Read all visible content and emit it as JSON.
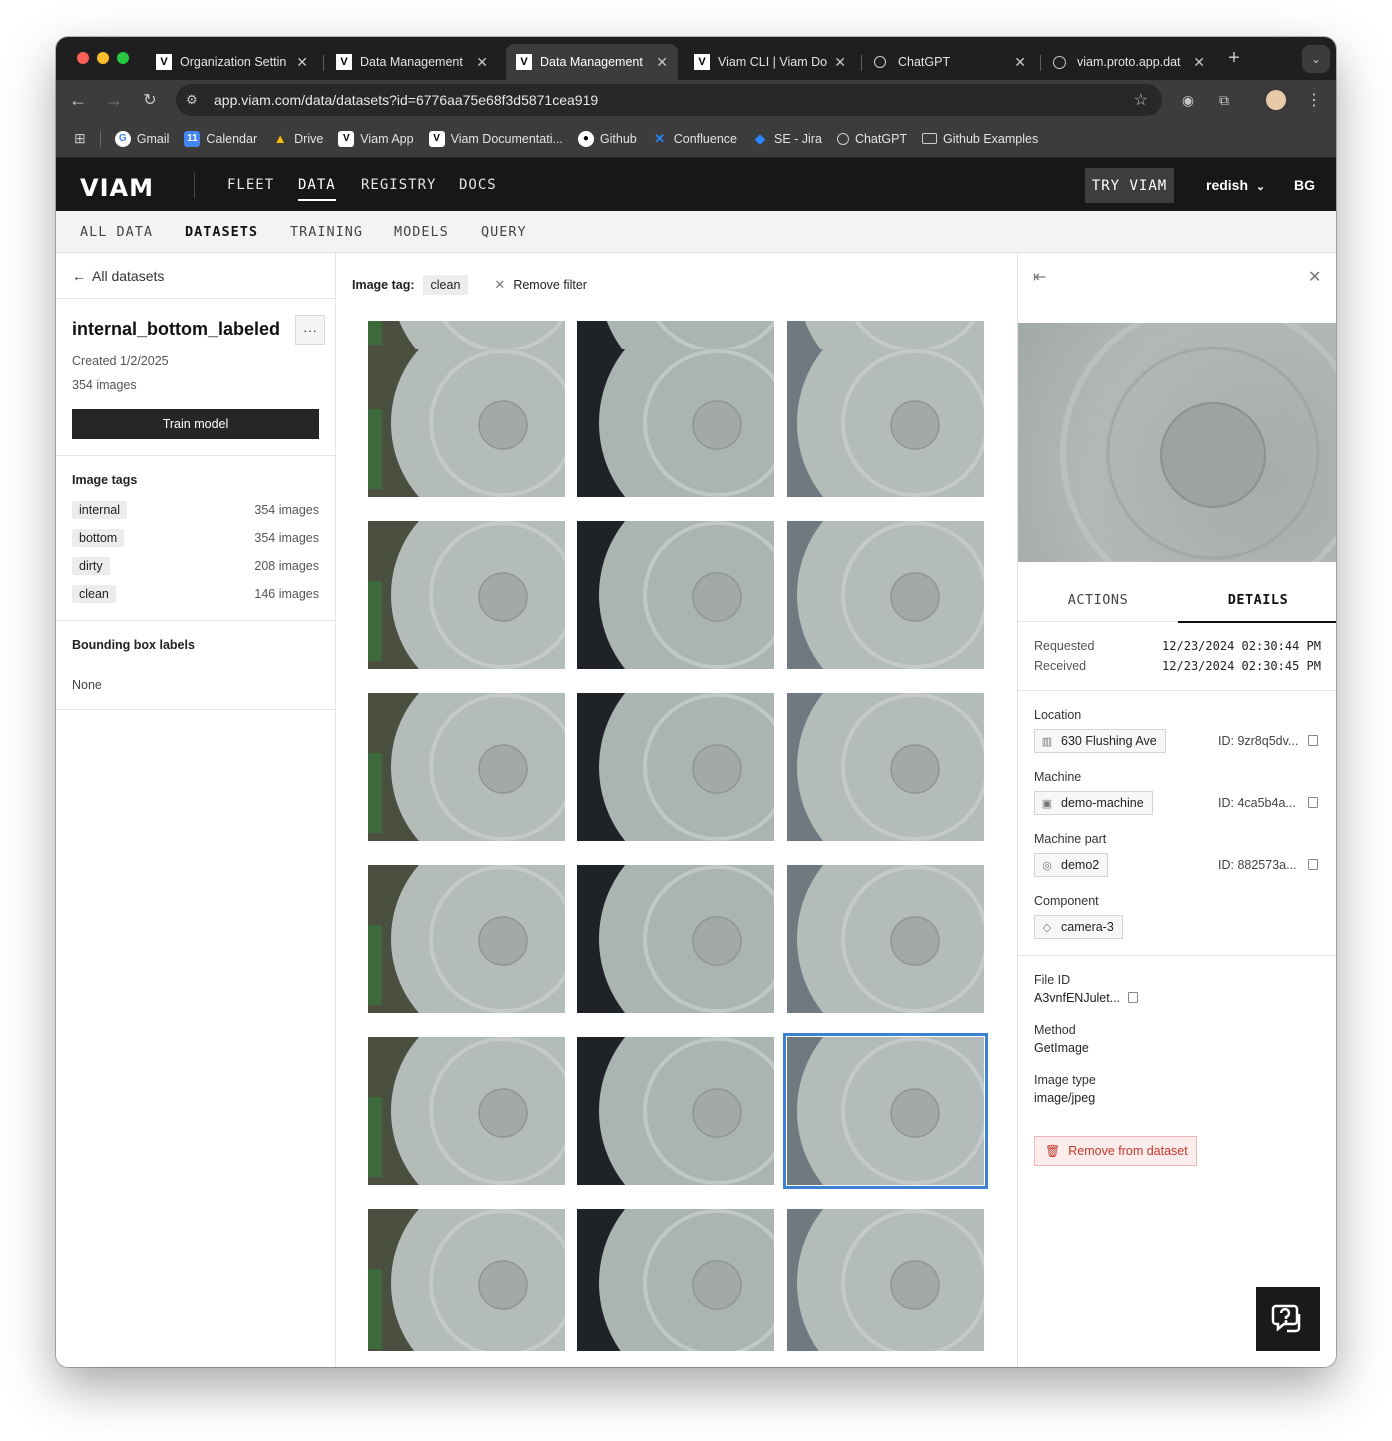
{
  "browser": {
    "tabs": [
      {
        "title": "Organization Settin",
        "icon": "viam-icon"
      },
      {
        "title": "Data Management",
        "icon": "viam-icon"
      },
      {
        "title": "Data Management",
        "icon": "viam-icon",
        "active": true
      },
      {
        "title": "Viam CLI | Viam Do",
        "icon": "viam-icon"
      },
      {
        "title": "ChatGPT",
        "icon": "openai-icon"
      },
      {
        "title": "viam.proto.app.dat",
        "icon": "globe-icon"
      }
    ],
    "url": "app.viam.com/data/datasets?id=6776aa75e68f3d5871cea919",
    "bookmarks": [
      "Gmail",
      "Calendar",
      "Drive",
      "Viam App",
      "Viam Documentati...",
      "Github",
      "Confluence",
      "SE - Jira",
      "ChatGPT",
      "Github Examples"
    ]
  },
  "app": {
    "logo": "VIAM",
    "nav": [
      "FLEET",
      "DATA",
      "REGISTRY",
      "DOCS"
    ],
    "try_viam": "TRY VIAM",
    "org": "redish",
    "user_initials": "BG",
    "subnav": [
      "ALL DATA",
      "DATASETS",
      "TRAINING",
      "MODELS",
      "QUERY"
    ]
  },
  "left": {
    "back_label": "All datasets",
    "dataset_name": "internal_bottom_labeled",
    "more_label": "···",
    "created": "Created 1/2/2025",
    "image_count": "354 images",
    "train_button": "Train model",
    "image_tags_title": "Image tags",
    "tags": [
      {
        "name": "internal",
        "count": "354 images"
      },
      {
        "name": "bottom",
        "count": "354 images"
      },
      {
        "name": "dirty",
        "count": "208 images"
      },
      {
        "name": "clean",
        "count": "146 images"
      }
    ],
    "bbox_title": "Bounding box labels",
    "bbox_value": "None"
  },
  "filter": {
    "label": "Image tag:",
    "value": "clean",
    "remove": "Remove filter"
  },
  "right": {
    "tabs": [
      "ACTIONS",
      "DETAILS"
    ],
    "requested_label": "Requested",
    "requested_value": "12/23/2024 02:30:44 PM",
    "received_label": "Received",
    "received_value": "12/23/2024 02:30:45 PM",
    "location_label": "Location",
    "location_value": "630 Flushing Ave",
    "location_id": "ID: 9zr8q5dv...",
    "machine_label": "Machine",
    "machine_value": "demo-machine",
    "machine_id": "ID: 4ca5b4a...",
    "part_label": "Machine part",
    "part_value": "demo2",
    "part_id": "ID: 882573a...",
    "component_label": "Component",
    "component_value": "camera-3",
    "file_id_label": "File ID",
    "file_id_value": "A3vnfENJulet...",
    "method_label": "Method",
    "method_value": "GetImage",
    "image_type_label": "Image type",
    "image_type_value": "image/jpeg",
    "remove_button": "Remove from dataset"
  }
}
